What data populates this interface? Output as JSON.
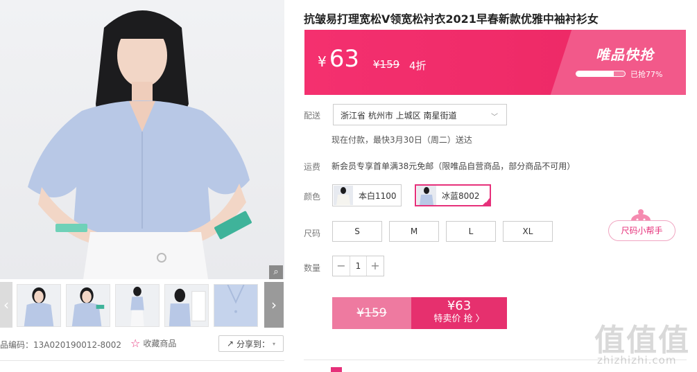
{
  "product": {
    "title": "抗皱易打理宽松V领宽松衬衣2021早春新款优雅中袖衬衫女"
  },
  "price_box": {
    "currency": "¥",
    "price": "63",
    "original_price": "¥159",
    "discount": "4折",
    "flash_title": "唯品快抢",
    "progress_text": "已抢77%",
    "progress_value": 0.77,
    "colors": {
      "main": "#f4306f",
      "accent": "#f2598a"
    }
  },
  "delivery": {
    "label": "配送",
    "address": "浙江省 杭州市 上城区 南星街道",
    "eta": "现在付款，最快3月30日（周二）送达"
  },
  "freight": {
    "label": "运费",
    "text": "新会员专享首单满38元免邮（限唯品自营商品，部分商品不可用）"
  },
  "color": {
    "label": "颜色",
    "options": [
      {
        "label": "本白1100",
        "selected": false
      },
      {
        "label": "冰蓝8002",
        "selected": true
      }
    ]
  },
  "size": {
    "label": "尺码",
    "options": [
      "S",
      "M",
      "L",
      "XL"
    ],
    "helper": "尺码小帮手"
  },
  "quantity": {
    "label": "数量",
    "minus": "−",
    "value": "1",
    "plus": "+"
  },
  "buy": {
    "original": "¥159",
    "sale_price": "¥63",
    "sale_text": "特卖价 抢 〉"
  },
  "gallery": {
    "sku_text": "品编码：13A020190012-8002",
    "favorite_label": "收藏商品",
    "share_label": "分享到：",
    "prev": "‹",
    "next": "›",
    "zoom": "⌕"
  },
  "brand_color": "#e6307a",
  "watermark": {
    "chars": [
      "值",
      "值",
      "值"
    ],
    "url": "zhizhizhi.com"
  }
}
